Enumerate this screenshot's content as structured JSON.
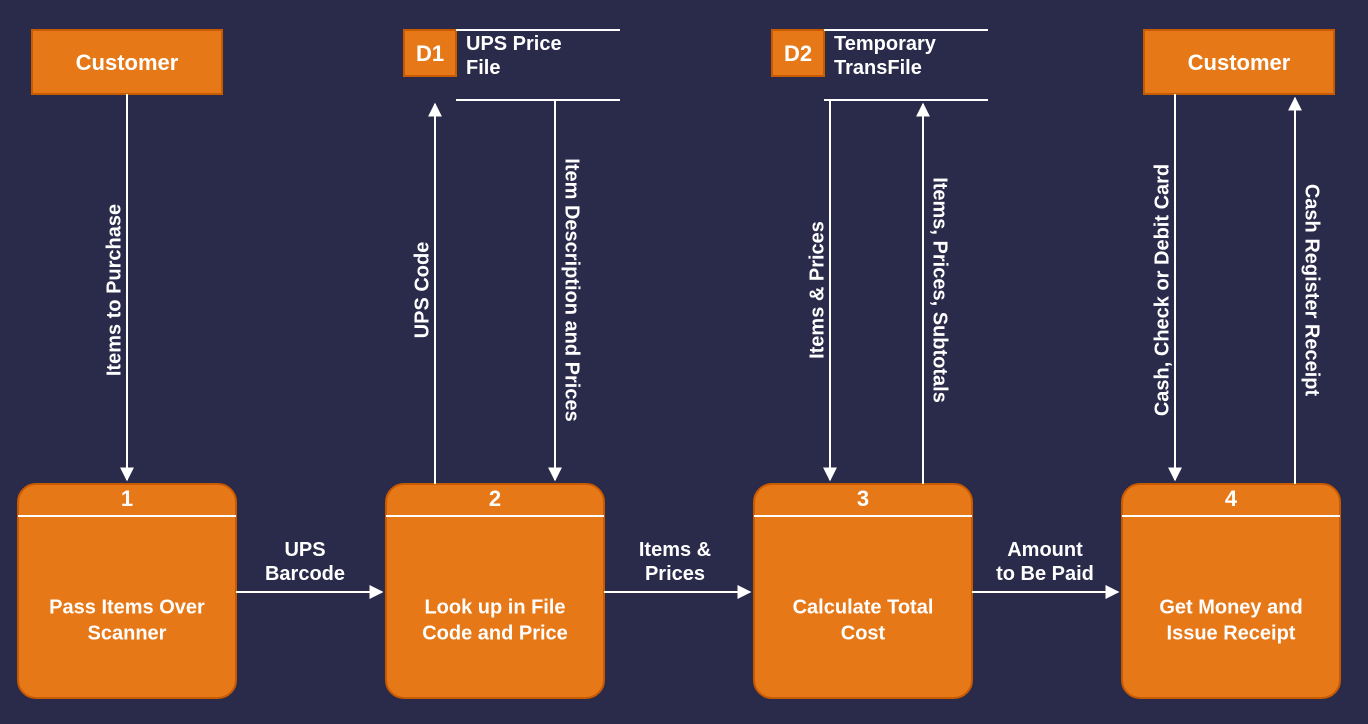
{
  "entities": {
    "customer_left": "Customer",
    "customer_right": "Customer"
  },
  "datastores": {
    "d1": {
      "id": "D1",
      "label1": "UPS Price",
      "label2": "File"
    },
    "d2": {
      "id": "D2",
      "label1": "Temporary",
      "label2": "TransFile"
    }
  },
  "processes": {
    "p1": {
      "num": "1",
      "line1": "Pass Items Over",
      "line2": "Scanner"
    },
    "p2": {
      "num": "2",
      "line1": "Look up in File",
      "line2": "Code and Price"
    },
    "p3": {
      "num": "3",
      "line1": "Calculate Total",
      "line2": "Cost"
    },
    "p4": {
      "num": "4",
      "line1": "Get Money and",
      "line2": "Issue Receipt"
    }
  },
  "flows": {
    "f1": "Items to Purchase",
    "f2": "UPS Code",
    "f3": "Item Description and Prices",
    "f4": "Items & Prices",
    "f5": "Items, Prices, Subtotals",
    "f6": "Cash, Check or Debit Card",
    "f7": "Cash Register Receipt",
    "h1a": "UPS",
    "h1b": "Barcode",
    "h2a": "Items &",
    "h2b": "Prices",
    "h3a": "Amount",
    "h3b": "to Be Paid"
  }
}
